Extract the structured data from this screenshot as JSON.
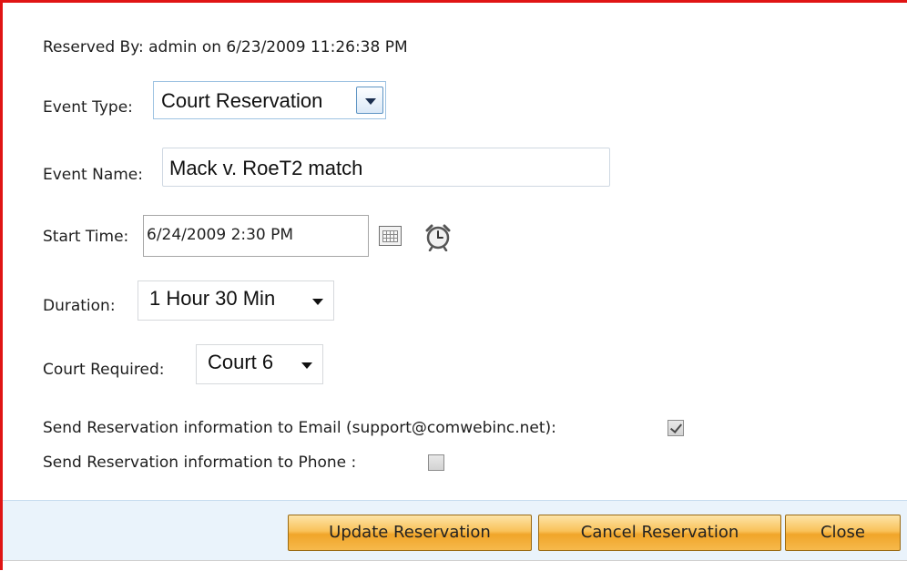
{
  "reserved_by": "Reserved By: admin on 6/23/2009 11:26:38 PM",
  "event_type": {
    "label": "Event Type:",
    "value": "Court Reservation"
  },
  "event_name": {
    "label": "Event Name:",
    "value": "Mack v. RoeT2 match"
  },
  "start_time": {
    "label": "Start Time:",
    "value": "6/24/2009 2:30 PM"
  },
  "duration": {
    "label": "Duration:",
    "value": "1 Hour 30 Min"
  },
  "court": {
    "label": "Court Required:",
    "value": "Court 6"
  },
  "notify": {
    "email_label": "Send Reservation information to Email (support@comwebinc.net):",
    "email_checked": true,
    "phone_label": "Send Reservation information to Phone :",
    "phone_checked": false
  },
  "buttons": {
    "update": "Update Reservation",
    "cancel": "Cancel Reservation",
    "close": "Close"
  },
  "colors": {
    "frame_border": "#e01414",
    "footer_bg": "#eaf3fb",
    "button": "#f6b94c"
  }
}
